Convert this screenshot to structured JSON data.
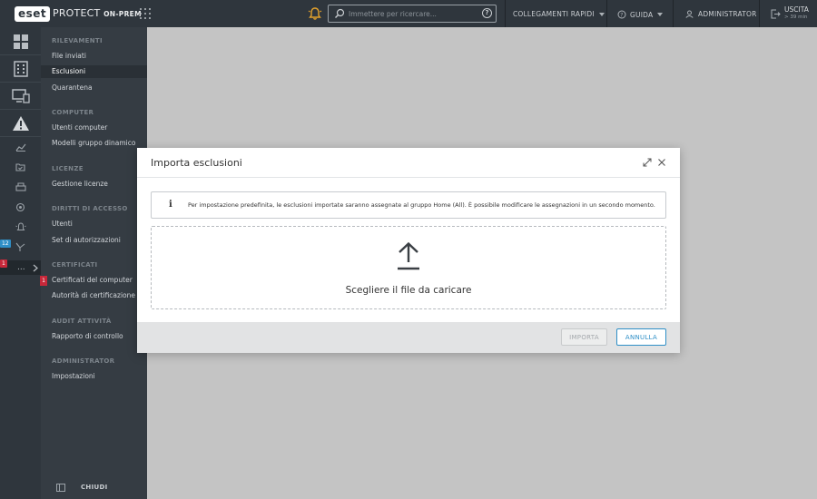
{
  "header": {
    "logo_text": "eset",
    "product_name": "PROTECT",
    "product_suffix": "ON-PREM",
    "search_placeholder": "Immettere per ricercare...",
    "quick_links_label": "COLLEGAMENTI RAPIDI",
    "help_label": "GUIDA",
    "user_label": "ADMINISTRATOR",
    "logout_label": "USCITA",
    "logout_timer": "> 39 min"
  },
  "rail": {
    "items": [
      {
        "icon": "dashboard-icon"
      },
      {
        "icon": "computers-icon"
      },
      {
        "icon": "devices-icon"
      },
      {
        "icon": "detections-icon"
      },
      {
        "icon": "reports-icon"
      },
      {
        "icon": "tasks-icon"
      },
      {
        "icon": "installers-icon"
      },
      {
        "icon": "policies-icon"
      },
      {
        "icon": "notifications-icon"
      },
      {
        "icon": "status-icon"
      },
      {
        "icon": "more-icon"
      }
    ],
    "status_badge": "12",
    "more_badge": "1",
    "more_label": "..."
  },
  "submenu": {
    "sections": [
      {
        "title": "RILEVAMENTI",
        "items": [
          "File inviati",
          "Esclusioni",
          "Quarantena"
        ]
      },
      {
        "title": "COMPUTER",
        "items": [
          "Utenti computer",
          "Modelli gruppo dinamico"
        ]
      },
      {
        "title": "LICENZE",
        "items": [
          "Gestione licenze"
        ]
      },
      {
        "title": "DIRITTI DI ACCESSO",
        "items": [
          "Utenti",
          "Set di autorizzazioni"
        ]
      },
      {
        "title": "CERTIFICATI",
        "items": [
          "Certificati del computer",
          "Autorità di certificazione"
        ]
      },
      {
        "title": "AUDIT ATTIVITÀ",
        "items": [
          "Rapporto di controllo"
        ]
      },
      {
        "title": "ADMINISTRATOR",
        "items": [
          "Impostazioni"
        ]
      }
    ],
    "active_item": "Esclusioni",
    "cert_badge": "1",
    "close_label": "CHIUDI"
  },
  "modal": {
    "title": "Importa esclusioni",
    "info_text": "Per impostazione predefinita, le esclusioni importate saranno assegnate al gruppo Home (All). È possibile modificare le assegnazioni in un secondo momento.",
    "info_icon": "i",
    "drop_label": "Scegliere il file da caricare",
    "import_button": "IMPORTA",
    "cancel_button": "ANNULLA"
  },
  "colors": {
    "topbar": "#2f363d",
    "submenu": "#353c43",
    "accent": "#2f8fc7",
    "badge_red": "#c8283a",
    "badge_blue": "#2f8fc7",
    "warning_orange": "#e2a12c"
  }
}
